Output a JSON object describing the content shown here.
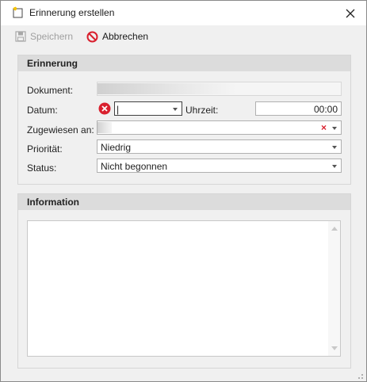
{
  "window": {
    "title": "Erinnerung erstellen"
  },
  "toolbar": {
    "save_label": "Speichern",
    "cancel_label": "Abbrechen"
  },
  "reminder_group": {
    "header": "Erinnerung",
    "document_label": "Dokument:",
    "date_label": "Datum:",
    "date_value": "|",
    "time_label": "Uhrzeit:",
    "time_value": "00:00",
    "assigned_label": "Zugewiesen an:",
    "priority_label": "Priorität:",
    "priority_value": "Niedrig",
    "status_label": "Status:",
    "status_value": "Nicht begonnen"
  },
  "info_group": {
    "header": "Information"
  },
  "colors": {
    "error": "#d9202e",
    "cancel_icon": "#d9202e",
    "header_bg": "#dcdcdc"
  }
}
